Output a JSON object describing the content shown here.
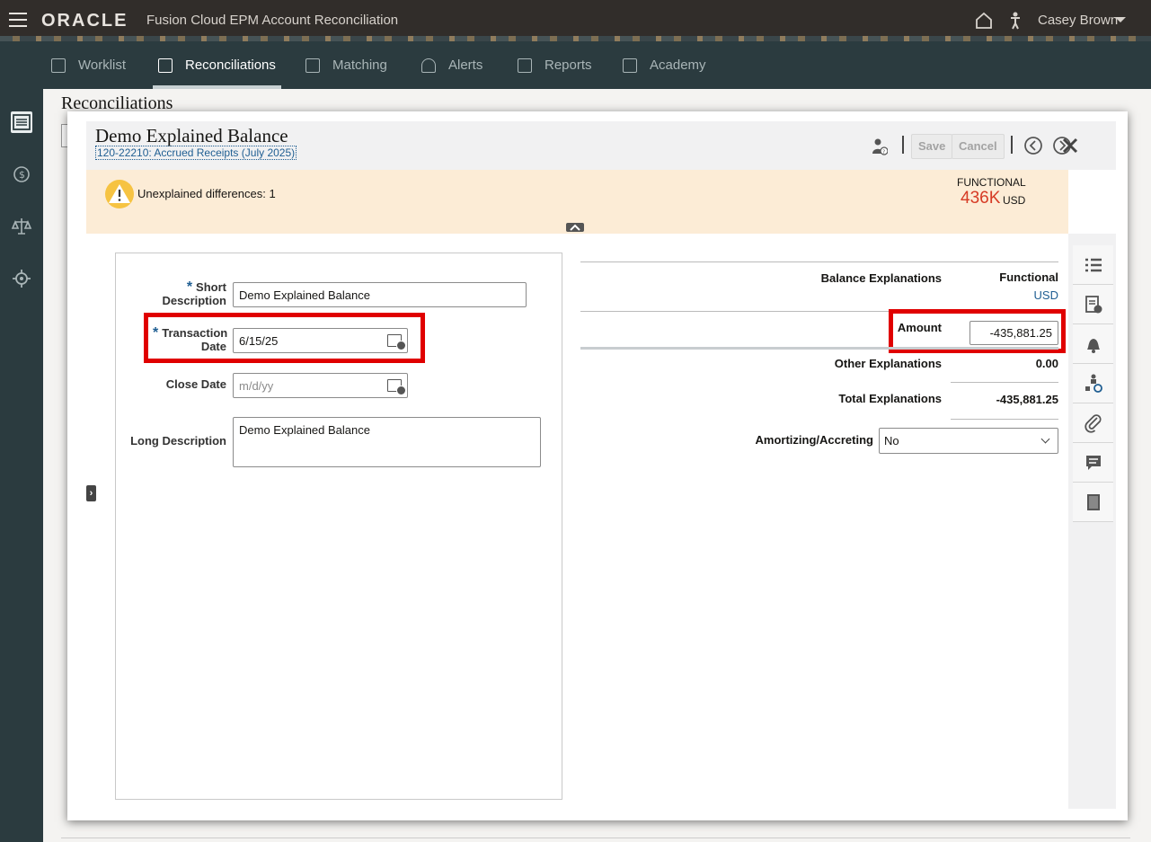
{
  "header": {
    "brand": "ORACLE",
    "product": "Fusion Cloud EPM Account Reconciliation",
    "user": "Casey Brown"
  },
  "nav": {
    "items": [
      {
        "label": "Worklist"
      },
      {
        "label": "Reconciliations"
      },
      {
        "label": "Matching"
      },
      {
        "label": "Alerts"
      },
      {
        "label": "Reports"
      },
      {
        "label": "Academy"
      }
    ]
  },
  "page": {
    "title": "Reconciliations"
  },
  "dialog": {
    "title": "Demo Explained Balance",
    "subtitle": "120-22210: Accrued Receipts (July 2025)",
    "save_label": "Save",
    "cancel_label": "Cancel",
    "message": "Unexplained differences: 1",
    "functional_label": "FUNCTIONAL",
    "functional_value": "436K",
    "functional_unit": "USD"
  },
  "form": {
    "short_desc_label_1": "Short",
    "short_desc_label_2": "Description",
    "short_desc_value": "Demo Explained Balance",
    "txn_date_label_1": "Transaction",
    "txn_date_label_2": "Date",
    "txn_date_value": "6/15/25",
    "close_date_label": "Close Date",
    "close_date_placeholder": "m/d/yy",
    "long_desc_label": "Long Description",
    "long_desc_value": "Demo Explained Balance"
  },
  "summary": {
    "balance_explanations_label": "Balance Explanations",
    "functional_header": "Functional",
    "currency": "USD",
    "amount_label": "Amount",
    "amount_value": "-435,881.25",
    "other_label": "Other Explanations",
    "other_value": "0.00",
    "total_label": "Total Explanations",
    "total_value": "-435,881.25",
    "amortizing_label": "Amortizing/Accreting",
    "amortizing_value": "No"
  },
  "colors": {
    "top_bar": "#312d2a",
    "nav_bar": "#2b3b3f",
    "message_band": "#fcecd6",
    "functional_value": "#d63b25",
    "highlight": "#e00000",
    "link": "#1f5e92"
  }
}
